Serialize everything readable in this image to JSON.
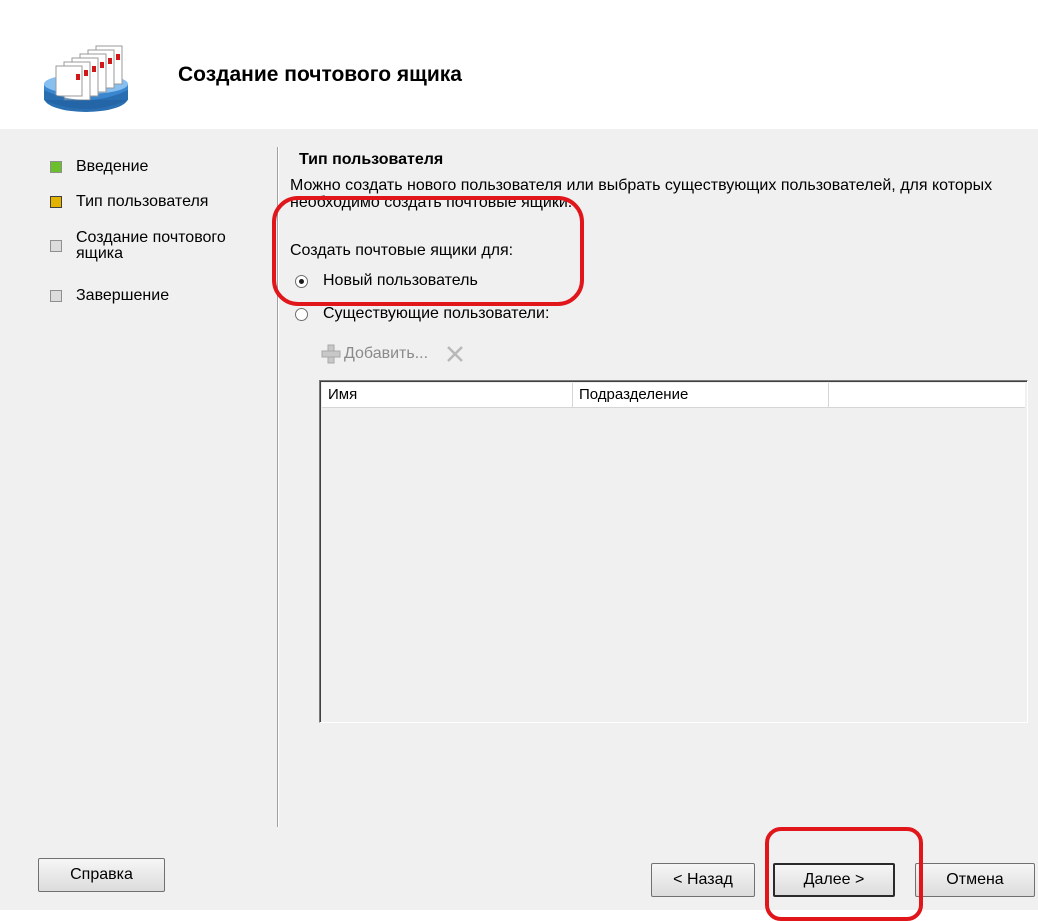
{
  "wizard": {
    "title": "Создание почтового ящика"
  },
  "steps": [
    {
      "label": "Введение",
      "state": "completed",
      "color": "#6abf2a"
    },
    {
      "label": "Тип пользователя",
      "state": "current",
      "color": "#e2b400"
    },
    {
      "label": "Создание почтового\nящика",
      "state": "pending",
      "color": "#dcdcdc"
    },
    {
      "label": "Завершение",
      "state": "pending",
      "color": "#dcdcdc"
    }
  ],
  "main": {
    "section_title": "Тип пользователя",
    "description": "Можно создать нового пользователя или выбрать существующих пользователей, для которых необходимо создать почтовые ящики.",
    "create_for_label": "Создать почтовые ящики для:",
    "options": [
      {
        "label": "Новый пользователь",
        "checked": true
      },
      {
        "label": "Существующие пользователи:",
        "checked": false
      }
    ],
    "toolbar": {
      "add_label": "Добавить...",
      "add_icon": "add-icon",
      "remove_icon": "delete-x-icon"
    },
    "list": {
      "columns": [
        "Имя",
        "Подразделение",
        ""
      ],
      "rows": []
    }
  },
  "buttons": {
    "help": "Справка",
    "back": "< Назад",
    "next": "Далее >",
    "cancel": "Отмена"
  },
  "colors": {
    "annotation": "#e0161b",
    "window_bg": "#f0f0f0"
  }
}
